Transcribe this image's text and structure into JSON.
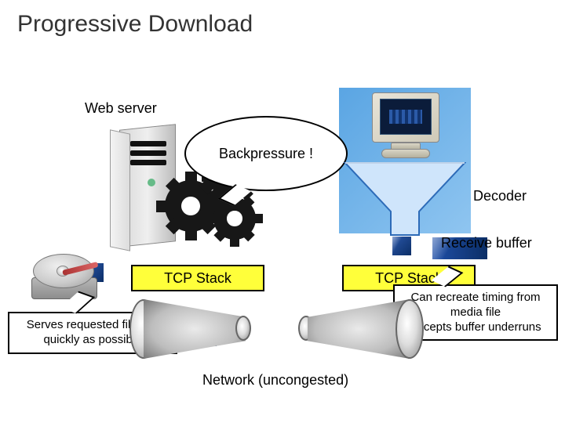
{
  "title": "Progressive Download",
  "labels": {
    "web_server": "Web server",
    "decoder": "Decoder",
    "receive_buffer": "Receive buffer",
    "network": "Network (uncongested)"
  },
  "tcp": {
    "left": "TCP Stack",
    "right": "TCP Stack"
  },
  "callouts": {
    "backpressure": "Backpressure !",
    "serves": "Serves requested files as\nquickly as possible",
    "decoder_note": "Can recreate timing from\nmedia file\nAccepts buffer underruns"
  },
  "icons": {
    "tower": "tower-server",
    "gears": "gears",
    "hdd": "hard-disk",
    "monitor": "crt-monitor",
    "funnel": "funnel",
    "packet": "packet-square"
  },
  "colors": {
    "tcp_fill": "#ffff3a",
    "packet": "#1a3e88",
    "panel": "#7ab6ea"
  }
}
